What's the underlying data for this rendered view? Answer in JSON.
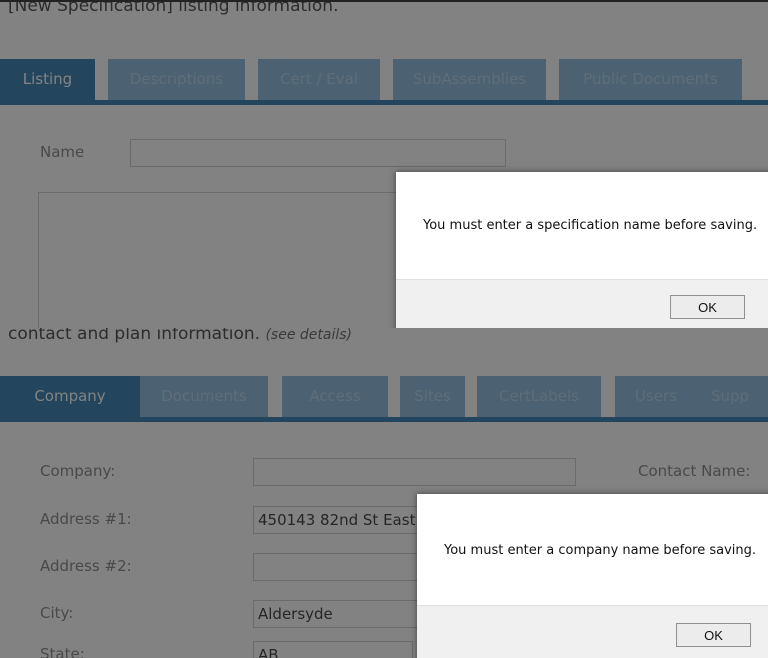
{
  "top_panel": {
    "intro": "[New Specification] listing information.",
    "tabs": [
      "Listing",
      "Descriptions",
      "Cert / Eval",
      "SubAssemblies",
      "Public Documents"
    ],
    "name_label": "Name",
    "name_value": "",
    "dialog": {
      "message": "You must enter a specification name before saving.",
      "ok_label": "OK"
    }
  },
  "bottom_panel": {
    "intro": "contact and plan information.",
    "intro_link": "(see details)",
    "tabs": [
      "Company",
      "Documents",
      "Access",
      "Sites",
      "CertLabels",
      "Users",
      "Supp"
    ],
    "labels": {
      "company": "Company:",
      "address1": "Address #1:",
      "address2": "Address #2:",
      "city": "City:",
      "state": "State:",
      "contact_name": "Contact Name:"
    },
    "values": {
      "company": "",
      "address1": "450143 82nd St East",
      "address2": "",
      "city": "Aldersyde",
      "state": "AB"
    },
    "dialog": {
      "message": "You must enter a company name before saving.",
      "ok_label": "OK"
    }
  },
  "colors": {
    "tab_active": "#1d6fa8",
    "tab_inactive": "#7eb3d8",
    "overlay": "#282828"
  }
}
